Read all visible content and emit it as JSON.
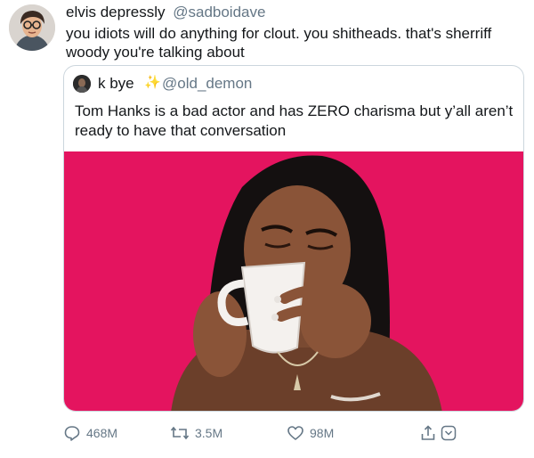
{
  "tweet": {
    "author_name": "elvis depressly",
    "author_handle": "@sadboidave",
    "text": "you idiots will do anything for clout. you shitheads. that's sherriff woody you're talking about",
    "avatar_icon": "cartoon-avatar-with-glasses"
  },
  "quote": {
    "author_name": "k bye",
    "sparkle_icon": "✨",
    "author_handle": "@old_demon",
    "text": "Tom Hanks is a bad actor and has ZERO charisma but y’all aren’t ready to have that conversation",
    "media_icon": "gif-woman-sipping-from-mug",
    "media_bg": "#e4145f"
  },
  "actions": {
    "replies": "468M",
    "retweets": "3.5M",
    "likes": "98M"
  },
  "colors": {
    "text": "#14171a",
    "muted": "#657786",
    "border": "#ccd6dd",
    "accent_pink": "#e4145f"
  }
}
